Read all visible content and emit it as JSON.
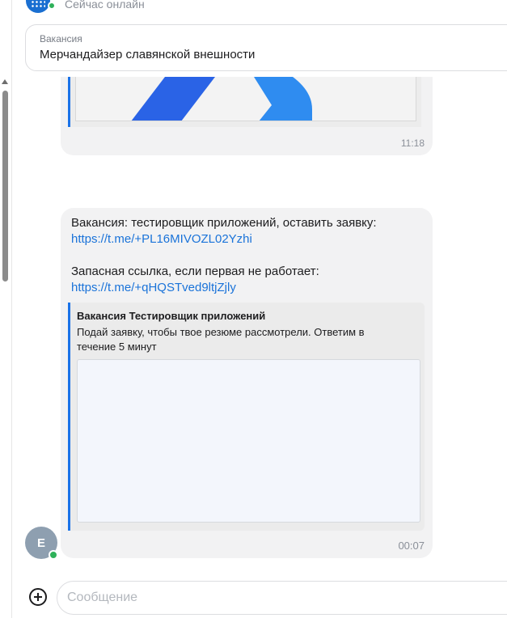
{
  "header": {
    "status": "Сейчас онлайн"
  },
  "vacancy": {
    "label": "Вакансия",
    "title": "Мерчандайзер славянской внешности"
  },
  "messages": [
    {
      "time": "11:18"
    },
    {
      "line1": "Вакансия: тестировщик приложений, оставить заявку:",
      "link1": "https://t.me/+PL16MIVOZL02Yzhi",
      "line2": "Запасная ссылка, если первая не работает:",
      "link2": "https://t.me/+qHQSTved9ltjZjly",
      "preview": {
        "title": "Вакансия Тестировщик приложений",
        "description": "Подай заявку, чтобы твое резюме рассмотрели. Ответим в течение 5 минут"
      },
      "time": "00:07"
    }
  ],
  "sender": {
    "initial": "Е"
  },
  "composer": {
    "placeholder": "Сообщение"
  },
  "colors": {
    "accent": "#1b73e8",
    "online": "#2fb15a",
    "bubble": "#f2f2f3"
  }
}
